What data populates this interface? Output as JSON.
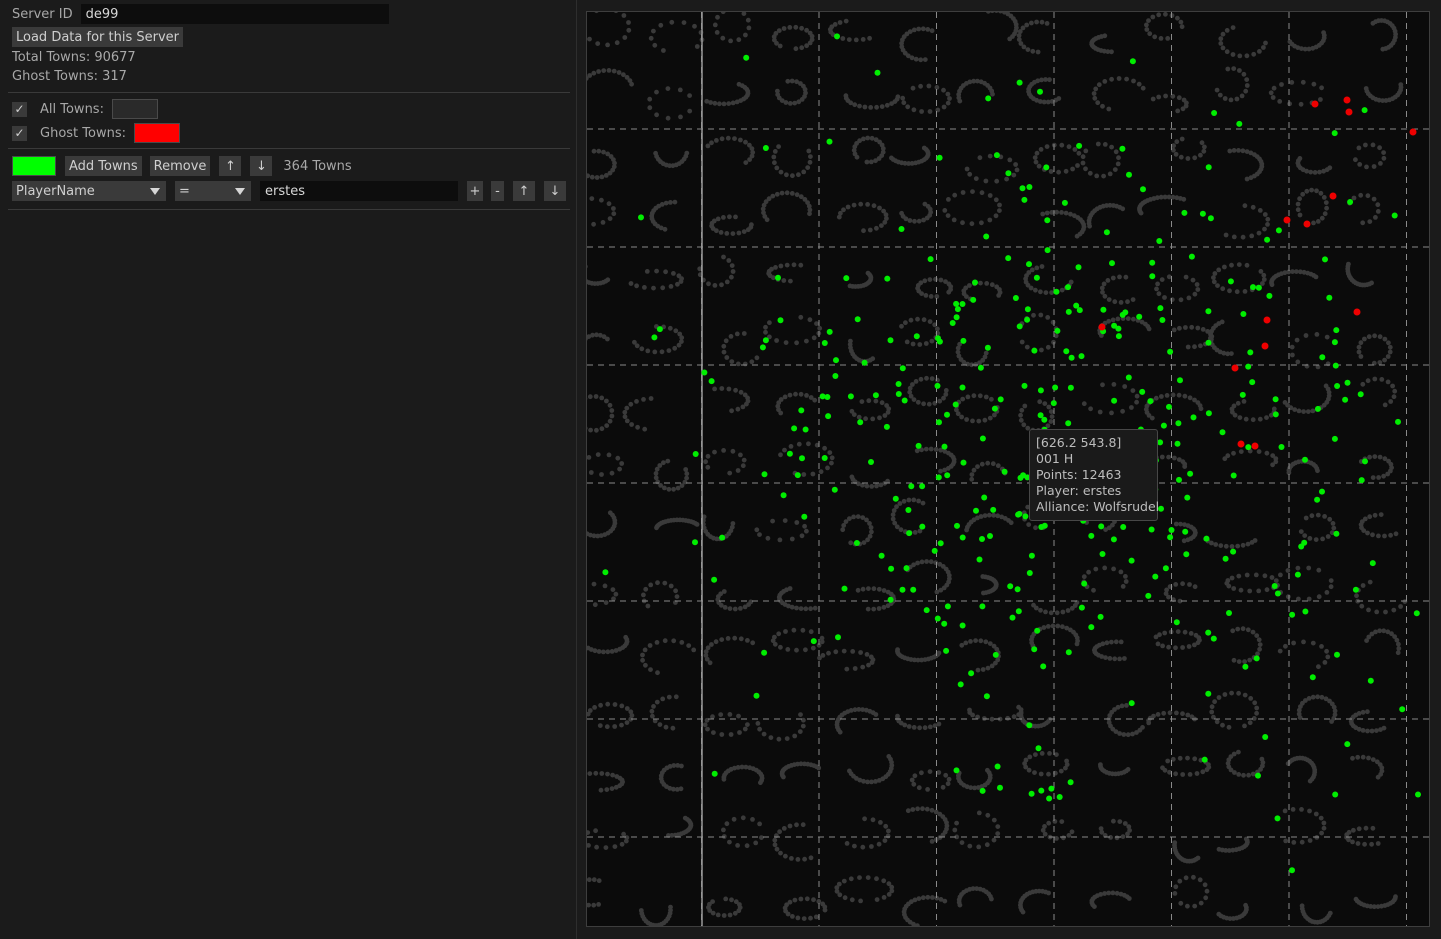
{
  "panel": {
    "server_id_label": "Server ID",
    "server_id_value": "de99",
    "load_button": "Load Data for this Server",
    "total_towns": "Total Towns: 90677",
    "ghost_towns": "Ghost Towns: 317",
    "all_towns_label": "All Towns:",
    "all_towns_checked": "✓",
    "all_towns_color": "#2a2a2a",
    "ghost_towns_label": "Ghost Towns:",
    "ghost_towns_checked": "✓",
    "ghost_towns_color": "#ff0000",
    "filter_color": "#00ff00",
    "add_towns_button": "Add Towns",
    "remove_button": "Remove",
    "up_arrow": "↑",
    "down_arrow": "↓",
    "town_count": "364 Towns",
    "field_select": "PlayerName",
    "operator_select": "=",
    "filter_value": "erstes",
    "plus_button": "+",
    "minus_button": "-"
  },
  "tooltip": {
    "coords": "[626.2 543.8]",
    "town_name": "001 H",
    "points": "Points: 12463",
    "player": "Player: erstes",
    "alliance": "Alliance: Wolfsrudel"
  },
  "map": {
    "background": "#0b0b0b",
    "town_color": "#3a3a3a",
    "player_town_color": "#00ee00",
    "ghost_town_color": "#ee0000",
    "grid_color": "#8a8a8a"
  }
}
